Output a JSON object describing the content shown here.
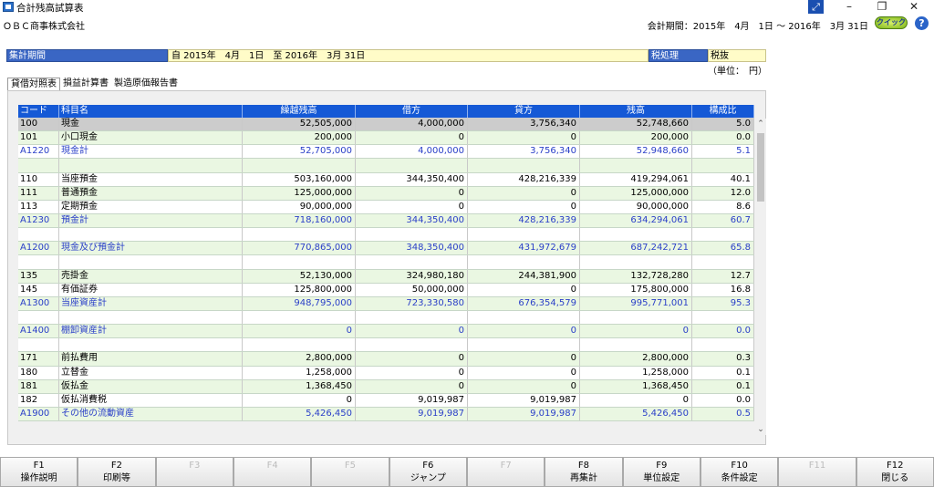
{
  "window": {
    "title": "合計残高試算表"
  },
  "header": {
    "company": "ＯＢＣ商事株式会社",
    "period": "会計期間：2015年　4月　1日 ～ 2016年　3月 31日",
    "quick_label": "クイック",
    "help_label": "?"
  },
  "conditions": {
    "period_label": "集計期間",
    "period_value": "自 2015年　4月　1日　至 2016年　3月 31日",
    "tax_label": "税処理",
    "tax_value": "税抜",
    "unit": "（単位：　円）"
  },
  "tabs": [
    "貸借対照表",
    "損益計算書",
    "製造原価報告書"
  ],
  "table": {
    "columns": [
      "コード",
      "科目名",
      "繰越残高",
      "借方",
      "貸方",
      "残高",
      "構成比"
    ],
    "rows": [
      {
        "code": "100",
        "name": "現金",
        "carry": "52,505,000",
        "debit": "4,000,000",
        "credit": "3,756,340",
        "balance": "52,748,660",
        "ratio": "5.0",
        "style": "sel"
      },
      {
        "code": "101",
        "name": "小口現金",
        "carry": "200,000",
        "debit": "0",
        "credit": "0",
        "balance": "200,000",
        "ratio": "0.0",
        "style": ""
      },
      {
        "code": "A1220",
        "name": "現金計",
        "carry": "52,705,000",
        "debit": "4,000,000",
        "credit": "3,756,340",
        "balance": "52,948,660",
        "ratio": "5.1",
        "style": "blue"
      },
      {
        "code": "",
        "name": "",
        "carry": "",
        "debit": "",
        "credit": "",
        "balance": "",
        "ratio": "",
        "style": ""
      },
      {
        "code": "110",
        "name": "当座預金",
        "carry": "503,160,000",
        "debit": "344,350,400",
        "credit": "428,216,339",
        "balance": "419,294,061",
        "ratio": "40.1",
        "style": ""
      },
      {
        "code": "111",
        "name": "普通預金",
        "carry": "125,000,000",
        "debit": "0",
        "credit": "0",
        "balance": "125,000,000",
        "ratio": "12.0",
        "style": ""
      },
      {
        "code": "113",
        "name": "定期預金",
        "carry": "90,000,000",
        "debit": "0",
        "credit": "0",
        "balance": "90,000,000",
        "ratio": "8.6",
        "style": ""
      },
      {
        "code": "A1230",
        "name": "預金計",
        "carry": "718,160,000",
        "debit": "344,350,400",
        "credit": "428,216,339",
        "balance": "634,294,061",
        "ratio": "60.7",
        "style": "blue"
      },
      {
        "code": "",
        "name": "",
        "carry": "",
        "debit": "",
        "credit": "",
        "balance": "",
        "ratio": "",
        "style": ""
      },
      {
        "code": "A1200",
        "name": "現金及び預金計",
        "carry": "770,865,000",
        "debit": "348,350,400",
        "credit": "431,972,679",
        "balance": "687,242,721",
        "ratio": "65.8",
        "style": "blue"
      },
      {
        "code": "",
        "name": "",
        "carry": "",
        "debit": "",
        "credit": "",
        "balance": "",
        "ratio": "",
        "style": ""
      },
      {
        "code": "135",
        "name": "売掛金",
        "carry": "52,130,000",
        "debit": "324,980,180",
        "credit": "244,381,900",
        "balance": "132,728,280",
        "ratio": "12.7",
        "style": ""
      },
      {
        "code": "145",
        "name": "有価証券",
        "carry": "125,800,000",
        "debit": "50,000,000",
        "credit": "0",
        "balance": "175,800,000",
        "ratio": "16.8",
        "style": ""
      },
      {
        "code": "A1300",
        "name": "当座資産計",
        "carry": "948,795,000",
        "debit": "723,330,580",
        "credit": "676,354,579",
        "balance": "995,771,001",
        "ratio": "95.3",
        "style": "blue"
      },
      {
        "code": "",
        "name": "",
        "carry": "",
        "debit": "",
        "credit": "",
        "balance": "",
        "ratio": "",
        "style": ""
      },
      {
        "code": "A1400",
        "name": "棚卸資産計",
        "carry": "0",
        "debit": "0",
        "credit": "0",
        "balance": "0",
        "ratio": "0.0",
        "style": "blue"
      },
      {
        "code": "",
        "name": "",
        "carry": "",
        "debit": "",
        "credit": "",
        "balance": "",
        "ratio": "",
        "style": ""
      },
      {
        "code": "171",
        "name": "前払費用",
        "carry": "2,800,000",
        "debit": "0",
        "credit": "0",
        "balance": "2,800,000",
        "ratio": "0.3",
        "style": ""
      },
      {
        "code": "180",
        "name": "立替金",
        "carry": "1,258,000",
        "debit": "0",
        "credit": "0",
        "balance": "1,258,000",
        "ratio": "0.1",
        "style": ""
      },
      {
        "code": "181",
        "name": "仮払金",
        "carry": "1,368,450",
        "debit": "0",
        "credit": "0",
        "balance": "1,368,450",
        "ratio": "0.1",
        "style": ""
      },
      {
        "code": "182",
        "name": "仮払消費税",
        "carry": "0",
        "debit": "9,019,987",
        "credit": "9,019,987",
        "balance": "0",
        "ratio": "0.0",
        "style": ""
      },
      {
        "code": "A1900",
        "name": "その他の流動資産",
        "carry": "5,426,450",
        "debit": "9,019,987",
        "credit": "9,019,987",
        "balance": "5,426,450",
        "ratio": "0.5",
        "style": "blue"
      }
    ]
  },
  "fkeys": [
    {
      "key": "F1",
      "label": "操作説明",
      "enabled": true
    },
    {
      "key": "F2",
      "label": "印刷等",
      "enabled": true
    },
    {
      "key": "F3",
      "label": "",
      "enabled": false
    },
    {
      "key": "F4",
      "label": "",
      "enabled": false
    },
    {
      "key": "F5",
      "label": "",
      "enabled": false
    },
    {
      "key": "F6",
      "label": "ジャンプ",
      "enabled": true
    },
    {
      "key": "F7",
      "label": "",
      "enabled": false
    },
    {
      "key": "F8",
      "label": "再集計",
      "enabled": true
    },
    {
      "key": "F9",
      "label": "単位設定",
      "enabled": true
    },
    {
      "key": "F10",
      "label": "条件設定",
      "enabled": true
    },
    {
      "key": "F11",
      "label": "",
      "enabled": false
    },
    {
      "key": "F12",
      "label": "閉じる",
      "enabled": true
    }
  ]
}
